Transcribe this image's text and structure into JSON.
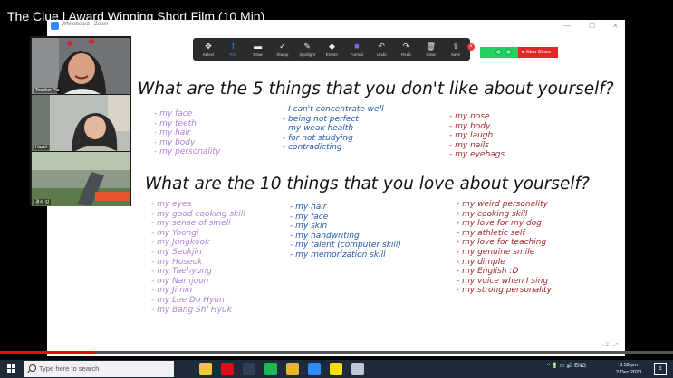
{
  "video": {
    "title": "The Clue | Award Winning Short Film (10 Min)",
    "progress_fraction": 0.14
  },
  "window": {
    "title": "Whiteboard - Zoom",
    "minimize_glyph": "—",
    "maximize_glyph": "☐",
    "close_glyph": "✕"
  },
  "toolbar": {
    "items": [
      {
        "label": "Select",
        "icon": "select-icon",
        "glyph": "✥"
      },
      {
        "label": "Text",
        "icon": "text-icon",
        "glyph": "T"
      },
      {
        "label": "Draw",
        "icon": "draw-icon",
        "glyph": "▬"
      },
      {
        "label": "Stamp",
        "icon": "stamp-icon",
        "glyph": "✓"
      },
      {
        "label": "Spotlight",
        "icon": "spotlight-icon",
        "glyph": "✎"
      },
      {
        "label": "Eraser",
        "icon": "eraser-icon",
        "glyph": "◆"
      },
      {
        "label": "Format",
        "icon": "format-icon",
        "glyph": "■"
      },
      {
        "label": "Undo",
        "icon": "undo-icon",
        "glyph": "↶"
      },
      {
        "label": "Redo",
        "icon": "redo-icon",
        "glyph": "↷"
      },
      {
        "label": "Clear",
        "icon": "clear-icon",
        "glyph": "🗑"
      },
      {
        "label": "Save",
        "icon": "save-icon",
        "glyph": "⇪"
      }
    ],
    "close_glyph": "×",
    "format_color": "#8e5cf0",
    "active_color": "#2d8cff"
  },
  "share": {
    "stop_label": "■ Stop Share"
  },
  "whiteboard": {
    "heading1": "What are the 5 things that you don't like about yourself?",
    "heading2": "What are the 10 things that you love about yourself?",
    "dislike_col1": [
      "- my face",
      "- my teeth",
      "- my hair",
      "- my body",
      "- my personality"
    ],
    "dislike_col2": [
      "- I can't concentrate well",
      "- being not perfect",
      "- my weak health",
      "- for not studying",
      "- contradicting"
    ],
    "dislike_col3": [
      "- my nose",
      "- my body",
      "- my laugh",
      "- my nails",
      "- my eyebags"
    ],
    "love_col1": [
      "- my eyes",
      "- my good cooking skill",
      "- my sense of smell",
      "- my Yoongi",
      "- my Jungkook",
      "- my Seokjin",
      "- my Hoseok",
      "- my Taehyung",
      "- my Namjoon",
      "- my Jimin",
      "- my Lee Do Hyun",
      "- my Bang Shi Hyuk"
    ],
    "love_col2": [
      "- my hair",
      "- my face",
      "- my skin",
      "- my handwriting",
      "- my talent (computer skill)",
      "- my memorization skill"
    ],
    "love_col3": [
      "- my weird personality",
      "- my cooking skill",
      "- my love for my dog",
      "- my athletic self",
      "- my love for teaching",
      "- my genuine smile",
      "- my dimple",
      "- my English :D",
      "- my voice when I sing",
      "- my strong personality"
    ],
    "colors": {
      "purple": "#b07fd8",
      "blue": "#2458a8",
      "red": "#a3262a"
    },
    "page_nav": "‹  2  ›   ⤢"
  },
  "participants": [
    {
      "name": "Teacher Pia"
    },
    {
      "name": "Hazel"
    },
    {
      "name": "경수 김"
    }
  ],
  "taskbar": {
    "search_placeholder": "Type here to search",
    "apps": [
      {
        "icon": "task-view-icon",
        "color": "#1c2a3a"
      },
      {
        "icon": "file-explorer-icon",
        "color": "#f3c33b"
      },
      {
        "icon": "netflix-icon",
        "color": "#e50914"
      },
      {
        "icon": "movies-icon",
        "color": "#2f3f57"
      },
      {
        "icon": "spotify-icon",
        "color": "#1db954"
      },
      {
        "icon": "chrome-icon",
        "color": "#e8b623"
      },
      {
        "icon": "zoom-icon",
        "color": "#2d8cff"
      },
      {
        "icon": "kakaotalk-icon",
        "color": "#f9e000"
      },
      {
        "icon": "app-icon",
        "color": "#c0c6cf"
      }
    ],
    "tray_text": "^  🔋  ▭  🔊  ENG",
    "time": "8:59 pm",
    "date": "2 Dec 2020",
    "notification_count": "3"
  }
}
